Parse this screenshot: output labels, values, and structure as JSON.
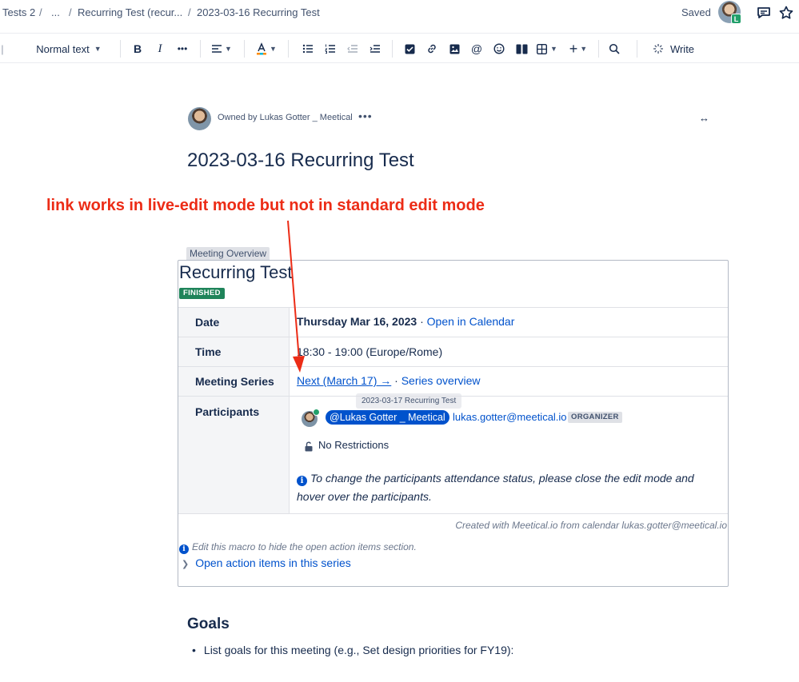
{
  "breadcrumb": {
    "items": [
      "Tests 2",
      "...",
      "Recurring Test (recur...",
      "2023-03-16 Recurring Test"
    ],
    "separator": "/"
  },
  "header": {
    "status": "Saved",
    "avatar_badge": "L",
    "icons": [
      "comment-icon",
      "star-icon"
    ]
  },
  "toolbar": {
    "text_style": "Normal text",
    "write_label": "Write",
    "icons": [
      "bold-icon",
      "italic-icon",
      "more-formatting-icon",
      "align-icon",
      "text-color-icon",
      "bullet-list-icon",
      "numbered-list-icon",
      "outdent-icon",
      "indent-icon",
      "task-icon",
      "link-icon",
      "image-icon",
      "mention-icon",
      "emoji-icon",
      "layout-icon",
      "table-icon",
      "insert-icon",
      "search-icon",
      "write-icon"
    ]
  },
  "page": {
    "owner_text": "Owned by Lukas Gotter _ Meetical",
    "owner_more": "•••",
    "width_toggle": "↔",
    "title": "2023-03-16 Recurring Test"
  },
  "annotation": {
    "text": "link works in live-edit mode but not in standard edit mode",
    "color": "#ec2c16"
  },
  "macro": {
    "tab_label": "Meeting Overview",
    "title": "Recurring Test",
    "status_badge": "FINISHED",
    "rows": {
      "date": {
        "label": "Date",
        "value": "Thursday Mar 16, 2023",
        "sep": " · ",
        "link": "Open in Calendar"
      },
      "time": {
        "label": "Time",
        "value": "18:30 - 19:00 (Europe/Rome)"
      },
      "series": {
        "label": "Meeting Series",
        "next_link": "Next (March 17) →",
        "sep": " · ",
        "overview_link": "Series overview",
        "tooltip": "2023-03-17 Recurring Test"
      },
      "participants": {
        "label": "Participants",
        "mention": "@Lukas Gotter _ Meetical",
        "email": "lukas.gotter@meetical.io",
        "role": "ORGANIZER",
        "restrictions": "No Restrictions",
        "note": "To change the participants attendance status, please close the edit mode and hover over the participants."
      }
    },
    "created_with": "Created with Meetical.io from calendar lukas.gotter@meetical.io",
    "edit_hint": "Edit this macro to hide the open action items section.",
    "open_actions": "Open action items in this series"
  },
  "goals": {
    "heading": "Goals",
    "items": [
      "List goals for this meeting (e.g., Set design priorities for FY19):"
    ]
  },
  "colors": {
    "link": "#0052cc",
    "finished_badge": "#1f845a",
    "mention_bg": "#0052cc"
  }
}
